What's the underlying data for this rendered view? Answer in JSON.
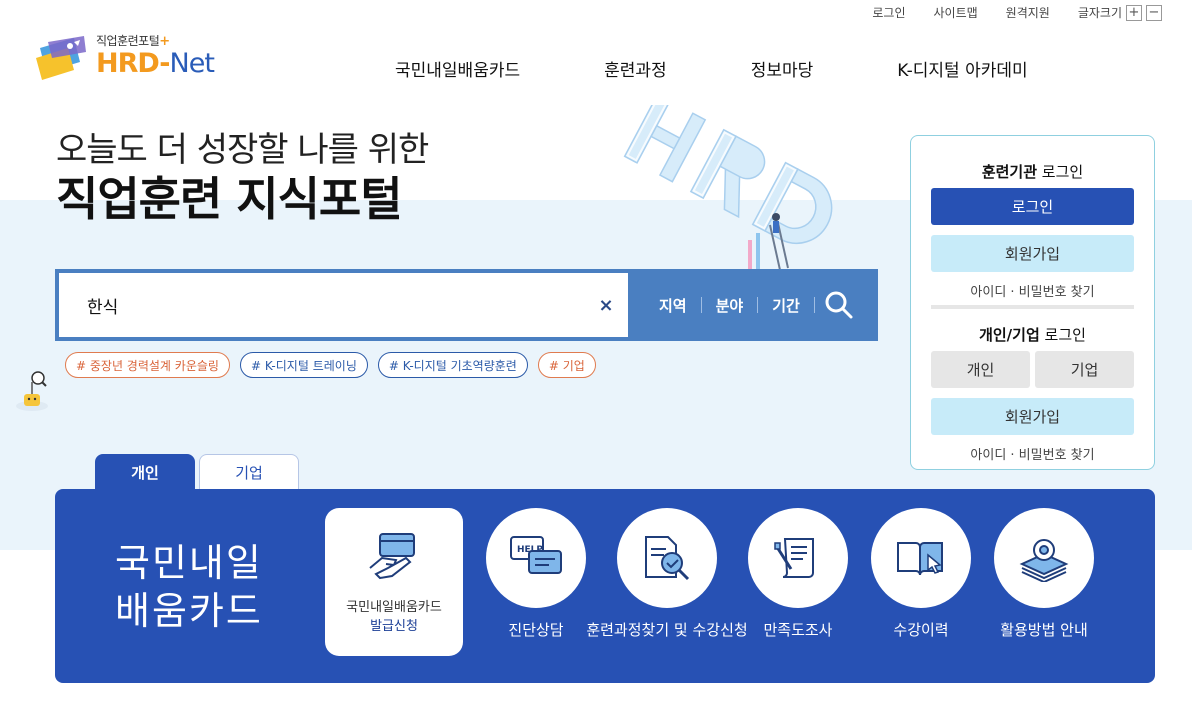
{
  "utility": {
    "login": "로그인",
    "sitemap": "사이트맵",
    "remote": "원격지원",
    "font_size": "글자크기",
    "plus": "+",
    "minus": "−"
  },
  "logo": {
    "tagline": "직업훈련포털",
    "plus": "+",
    "name_hrd": "HRD-",
    "name_net": "Net"
  },
  "nav": {
    "items": [
      "국민내일배움카드",
      "훈련과정",
      "정보마당",
      "K-디지털 아카데미"
    ]
  },
  "hero": {
    "subtitle": "오늘도 더 성장할 나를 위한",
    "title": "직업훈련 지식포털"
  },
  "search": {
    "value": "한식",
    "clear": "×",
    "filters": [
      "지역",
      "분야",
      "기간"
    ]
  },
  "tags": [
    {
      "label": "# 중장년 경력설계 카운슬링",
      "color": "orange"
    },
    {
      "label": "# K-디지털 트레이닝",
      "color": "blue"
    },
    {
      "label": "# K-디지털 기초역량훈련",
      "color": "blue"
    },
    {
      "label": "# 기업",
      "color": "orange"
    }
  ],
  "login_panel": {
    "org_title_bold": "훈련기관",
    "org_title_rest": " 로그인",
    "org_login": "로그인",
    "org_signup": "회원가입",
    "org_find": "아이디 · 비밀번호 찾기",
    "personal_title_bold": "개인/기업",
    "personal_title_rest": " 로그인",
    "personal": "개인",
    "company": "기업",
    "personal_signup": "회원가입",
    "personal_find": "아이디 · 비밀번호 찾기"
  },
  "tabs": {
    "active": "개인",
    "inactive": "기업"
  },
  "panel": {
    "title": "국민내일배움카드",
    "big_card": {
      "line1": "국민내일배움카드",
      "line2": "발급신청"
    },
    "services": [
      {
        "label": "진단상담",
        "icon": "help-chat-icon"
      },
      {
        "label": "훈련과정찾기 및 수강신청",
        "icon": "document-search-icon"
      },
      {
        "label": "만족도조사",
        "icon": "survey-scroll-icon"
      },
      {
        "label": "수강이력",
        "icon": "book-click-icon"
      },
      {
        "label": "활용방법 안내",
        "icon": "gear-stack-icon"
      }
    ]
  },
  "colors": {
    "primary": "#2751b4",
    "search_bar": "#4a7fc1",
    "accent_orange": "#f39a1f",
    "light_blue": "#c7ebf9",
    "band": "#eaf4fb"
  }
}
